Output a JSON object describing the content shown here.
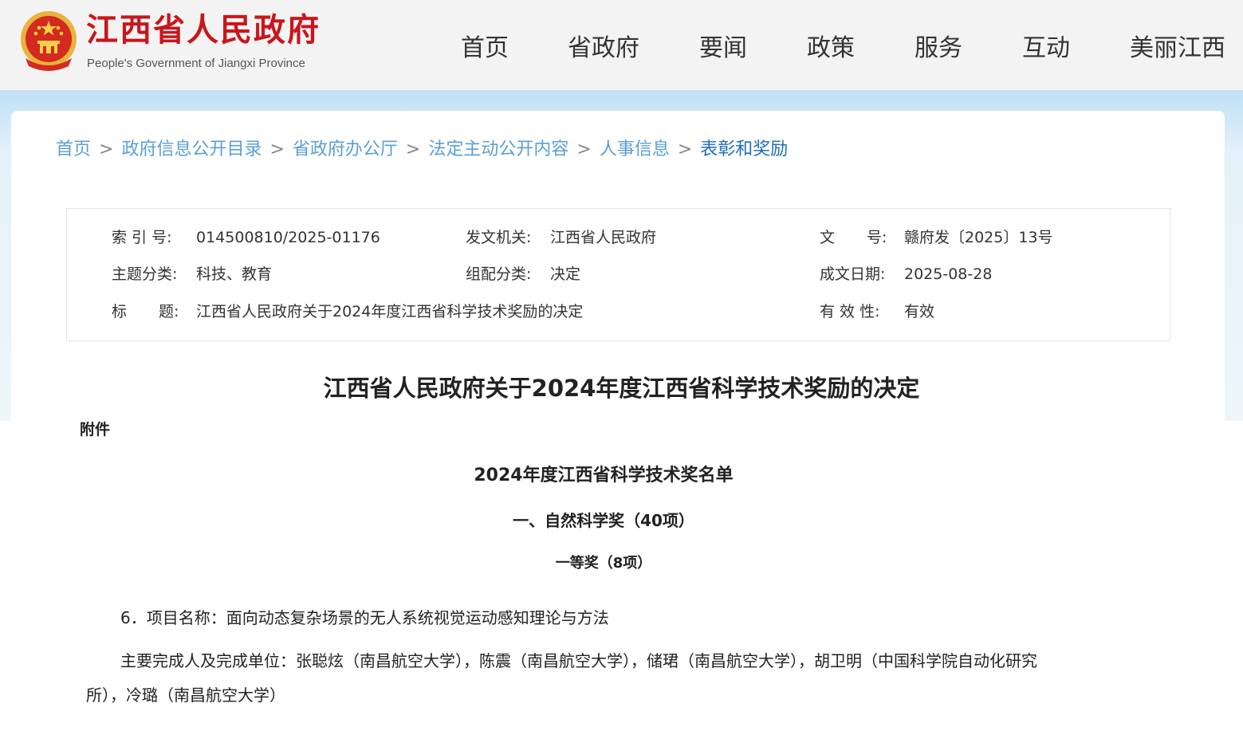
{
  "header": {
    "logo_cn": "江西省人民政府",
    "logo_en": "People's Government of Jiangxi Province",
    "emblem_icon": "national-emblem-icon",
    "nav": [
      "首页",
      "省政府",
      "要闻",
      "政策",
      "服务",
      "互动",
      "美丽江西"
    ]
  },
  "breadcrumb": {
    "items": [
      "首页",
      "政府信息公开目录",
      "省政府办公厅",
      "法定主动公开内容",
      "人事信息",
      "表彰和奖励"
    ],
    "separator": ">"
  },
  "meta": {
    "index_label": "索 引 号:",
    "index_value": "014500810/2025-01176",
    "issuer_label": "发文机关:",
    "issuer_value": "江西省人民政府",
    "docno_label": "文 号:",
    "docno_value": "赣府发〔2025〕13号",
    "topic_label": "主题分类:",
    "topic_value": "科技、教育",
    "category_label": "组配分类:",
    "category_value": "决定",
    "date_label": "成文日期:",
    "date_value": "2025-08-28",
    "title_label": "标 题:",
    "title_value": "江西省人民政府关于2024年度江西省科学技术奖励的决定",
    "valid_label": "有 效 性:",
    "valid_value": "有效"
  },
  "article": {
    "title": "江西省人民政府关于2024年度江西省科学技术奖励的决定",
    "attachment": "附件",
    "list_title": "2024年度江西省科学技术奖名单",
    "section": "一、自然科学奖（40项）",
    "grade": "一等奖（8项）",
    "item_line": "6．项目名称：面向动态复杂场景的无人系统视觉运动感知理论与方法",
    "people_line1": "主要完成人及完成单位：张聪炫（南昌航空大学），陈震（南昌航空大学），储珺（南昌航空大学），胡卫明（中国科学院自动化研究",
    "people_line2": "所），冷璐（南昌航空大学）"
  },
  "colors": {
    "brand_red": "#c8161d",
    "link_blue": "#5a9fd4",
    "current_blue": "#1f6fb5"
  }
}
